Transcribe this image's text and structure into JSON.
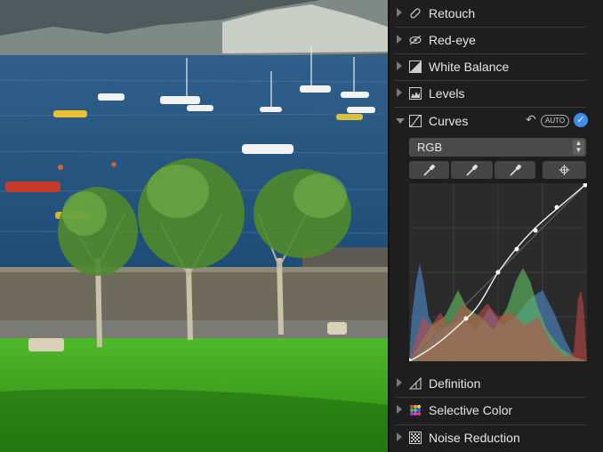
{
  "adjustments": {
    "retouch": "Retouch",
    "redeye": "Red-eye",
    "white_balance": "White Balance",
    "levels": "Levels",
    "curves": "Curves",
    "definition": "Definition",
    "selective_color": "Selective Color",
    "noise_reduction": "Noise Reduction"
  },
  "curves": {
    "auto_label": "AUTO",
    "channel_value": "RGB",
    "enabled": true
  },
  "colors": {
    "panel_bg": "#1e1e1e",
    "accent": "#3b8df0",
    "histogram_blue": "#4a7fb8",
    "histogram_green": "#5cb860",
    "histogram_red": "#c84a46"
  },
  "icons": {
    "retouch": "bandage-icon",
    "redeye": "eye-slash-icon",
    "white_balance": "white-balance-icon",
    "levels": "levels-icon",
    "curves": "curves-icon",
    "definition": "definition-icon",
    "selective_color": "color-dots-icon",
    "noise_reduction": "noise-icon"
  }
}
